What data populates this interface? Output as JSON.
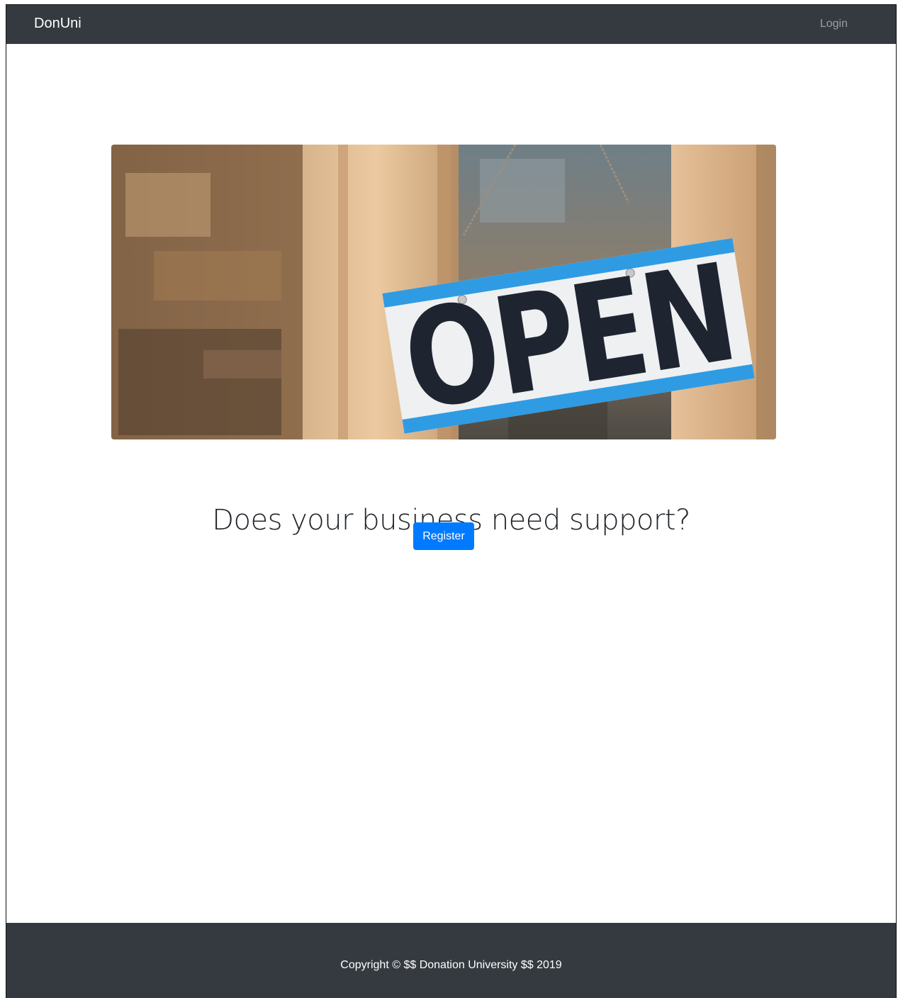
{
  "navbar": {
    "brand": "DonUni",
    "login_label": "Login"
  },
  "hero": {
    "sign_text": "OPEN"
  },
  "main": {
    "headline": "Does your business need support?",
    "register_label": "Register"
  },
  "footer": {
    "copyright": "Copyright © $$ Donation University $$ 2019"
  },
  "colors": {
    "navbar_bg": "#343a40",
    "primary": "#007bff",
    "sign_stripe": "#2f9be3"
  }
}
